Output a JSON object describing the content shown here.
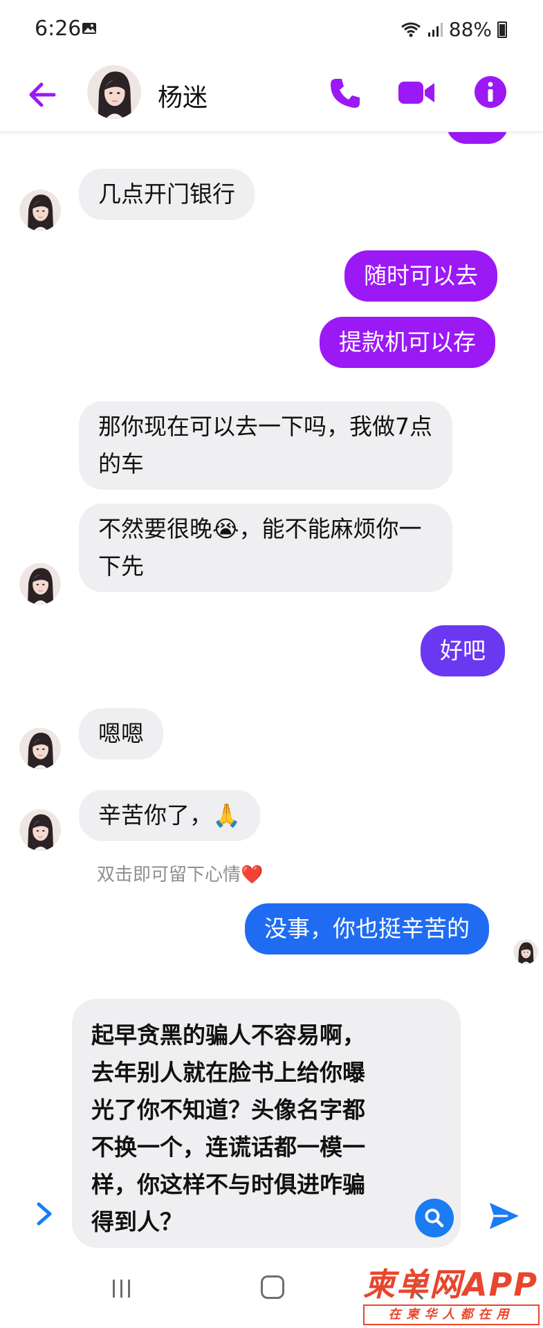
{
  "status_bar": {
    "time": "6:26",
    "battery": "88%"
  },
  "header": {
    "contact_name": "杨迷"
  },
  "messages": [
    {
      "side": "in",
      "text": "几点开门银行"
    },
    {
      "side": "out",
      "text": "随时可以去"
    },
    {
      "side": "out",
      "text": "提款机可以存"
    },
    {
      "side": "in",
      "text": "那你现在可以去一下吗，我做7点的车"
    },
    {
      "side": "in",
      "text": "不然要很晚😭，能不能麻烦你一下先"
    },
    {
      "side": "out",
      "text": "好吧"
    },
    {
      "side": "in",
      "text": "嗯嗯"
    },
    {
      "side": "in",
      "text": "辛苦你了，🙏"
    },
    {
      "side": "out",
      "text": "没事，你也挺辛苦的"
    }
  ],
  "reaction_hint": "双击即可留下心情",
  "reaction_hint_emoji": "❤️",
  "composer": {
    "text": "起早贪黑的骗人不容易啊，去年别人就在脸书上给你曝光了你不知道？头像名字都不换一个，连谎话都一模一样，你这样不与时俱进咋骗得到人？"
  },
  "watermark": {
    "brand": "柬单网APP",
    "tagline": "在柬华人都在用"
  },
  "colors": {
    "accent": "#9b19f5",
    "outgoing_purple": "#9b19f5",
    "outgoing_indigo": "#6a38f0",
    "outgoing_blue": "#1f6cf2",
    "incoming": "#efeff1",
    "watermark": "#e8462d"
  },
  "icons": [
    "back-arrow-icon",
    "phone-icon",
    "video-camera-icon",
    "info-icon",
    "chevron-right-icon",
    "search-icon",
    "send-icon"
  ]
}
